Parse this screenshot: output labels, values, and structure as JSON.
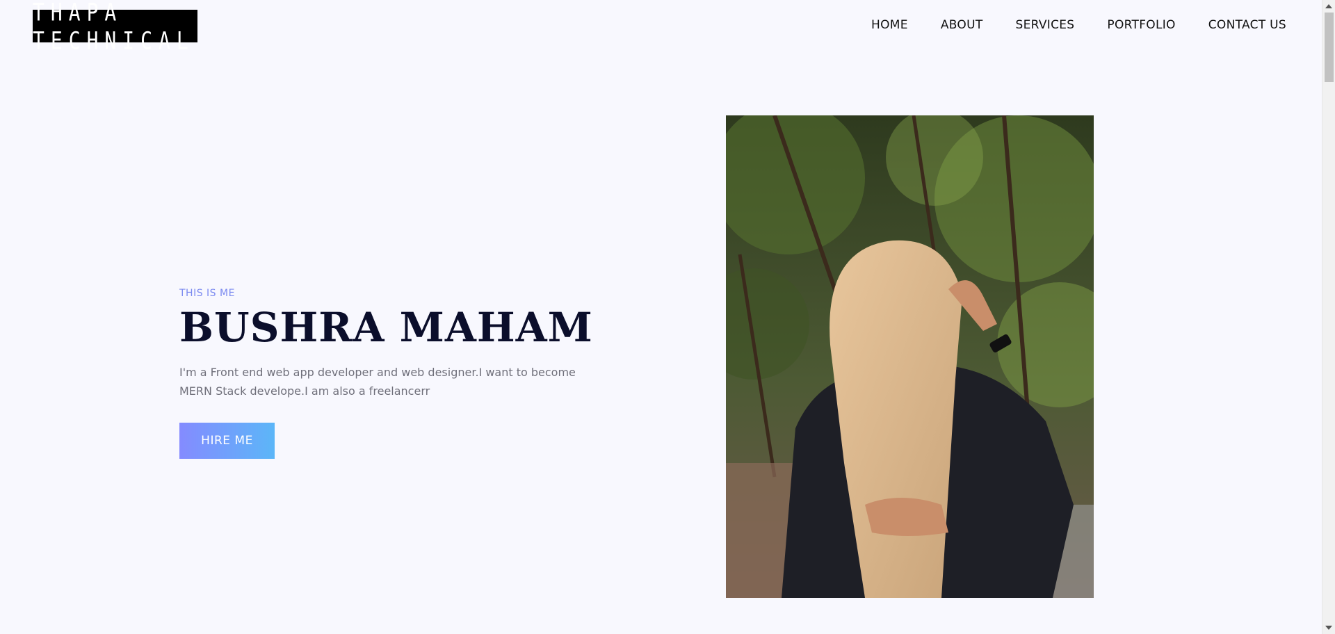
{
  "brand": {
    "logo_text": "THAPA TECHNICAL"
  },
  "nav": {
    "items": [
      {
        "label": "HOME"
      },
      {
        "label": "ABOUT"
      },
      {
        "label": "SERVICES"
      },
      {
        "label": "PORTFOLIO"
      },
      {
        "label": "CONTACT US"
      }
    ]
  },
  "hero": {
    "eyebrow": "THIS IS ME",
    "name": "BUSHRA MAHAM",
    "description": "I'm a Front end web app developer and web designer.I want to become MERN Stack develope.I am also a freelancerr",
    "cta_label": "HIRE ME",
    "cta_gradient": [
      "#848bff",
      "#5cb6f8"
    ],
    "photo_icon": "portrait-photo"
  },
  "colors": {
    "background": "#f8f8fe",
    "eyebrow": "#7b8af0",
    "name": "#0b0e2b",
    "text": "#6f6f7a"
  }
}
